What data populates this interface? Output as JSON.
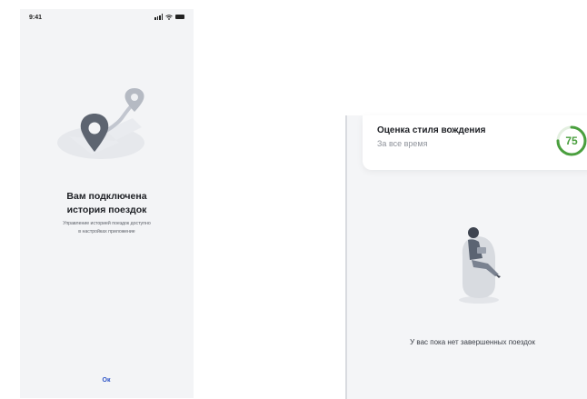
{
  "left_screen": {
    "status_bar": {
      "time": "9:41",
      "icons": [
        "signal-icon",
        "wifi-icon",
        "battery-icon"
      ]
    },
    "illustration": "route-pin-illustration",
    "title_line1": "Вам подключена",
    "title_line2": "история поездок",
    "description_line1": "Управление историей поездок доступно",
    "description_line2": "в настройках приложение",
    "ok_label": "Ок"
  },
  "right_screen": {
    "score_card": {
      "title": "Оценка стиля вождения",
      "subtitle": "За все время",
      "score": "75",
      "score_fraction": 0.75,
      "score_color": "#4a9f3e"
    },
    "illustration": "man-in-chair-illustration",
    "empty_message": "У вас пока нет завершенных поездок"
  },
  "colors": {
    "accent_blue": "#2b53c7",
    "text_dark": "#1d1f24",
    "background": "#f3f4f6"
  }
}
